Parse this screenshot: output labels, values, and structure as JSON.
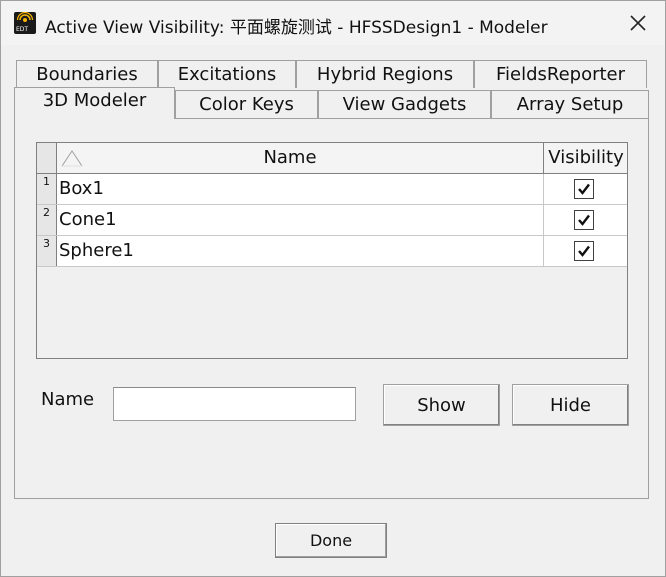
{
  "window": {
    "title": "Active View Visibility: 平面螺旋测试 - HFSSDesign1 - Modeler",
    "app_icon": "edt-icon",
    "app_icon_text": "EDT",
    "close_icon": "close-icon"
  },
  "tabs": {
    "row_back": [
      "Boundaries",
      "Excitations",
      "Hybrid Regions",
      "FieldsReporter"
    ],
    "row_front": [
      "3D Modeler",
      "Color Keys",
      "View Gadgets",
      "Array Setup"
    ],
    "active": "3D Modeler"
  },
  "grid": {
    "columns": [
      "Name",
      "Visibility"
    ],
    "rows": [
      {
        "num": "1",
        "name": "Box1",
        "visible": true
      },
      {
        "num": "2",
        "name": "Cone1",
        "visible": true
      },
      {
        "num": "3",
        "name": "Sphere1",
        "visible": true
      }
    ]
  },
  "form": {
    "name_label": "Name",
    "name_value": "",
    "show_label": "Show",
    "hide_label": "Hide"
  },
  "footer": {
    "done_label": "Done"
  }
}
